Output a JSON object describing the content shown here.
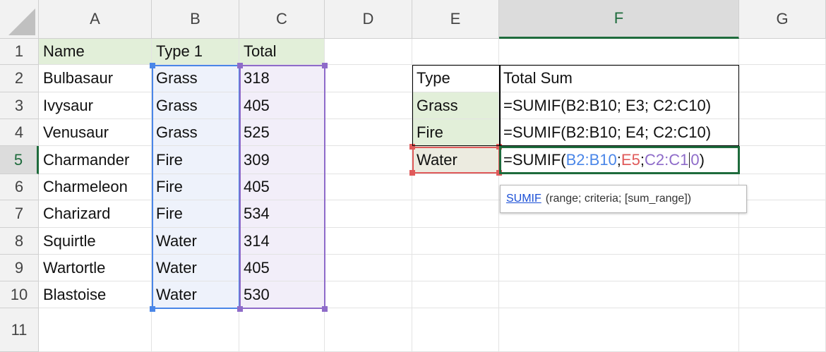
{
  "columns": [
    "A",
    "B",
    "C",
    "D",
    "E",
    "F",
    "G"
  ],
  "rows": [
    "1",
    "2",
    "3",
    "4",
    "5",
    "6",
    "7",
    "8",
    "9",
    "10",
    "11"
  ],
  "selected_column": "F",
  "selected_row": "5",
  "headers": {
    "name": "Name",
    "type1": "Type 1",
    "total": "Total"
  },
  "pokemon": [
    {
      "name": "Bulbasaur",
      "type": "Grass",
      "total": "318"
    },
    {
      "name": "Ivysaur",
      "type": "Grass",
      "total": "405"
    },
    {
      "name": "Venusaur",
      "type": "Grass",
      "total": "525"
    },
    {
      "name": "Charmander",
      "type": "Fire",
      "total": "309"
    },
    {
      "name": "Charmeleon",
      "type": "Fire",
      "total": "405"
    },
    {
      "name": "Charizard",
      "type": "Fire",
      "total": "534"
    },
    {
      "name": "Squirtle",
      "type": "Water",
      "total": "314"
    },
    {
      "name": "Wartortle",
      "type": "Water",
      "total": "405"
    },
    {
      "name": "Blastoise",
      "type": "Water",
      "total": "530"
    }
  ],
  "summary": {
    "type_header": "Type",
    "sum_header": "Total Sum",
    "rows": [
      {
        "type": "Grass",
        "formula": "=SUMIF(B2:B10; E3; C2:C10)"
      },
      {
        "type": "Fire",
        "formula": "=SUMIF(B2:B10; E4; C2:C10)"
      }
    ],
    "active": {
      "type": "Water",
      "formula_prefix": "=SUMIF(",
      "range": "B2:B10",
      "sep1": "; ",
      "criteria": "E5",
      "sep2": "; ",
      "sum_range_head": "C2:C1",
      "sum_range_tail": "0",
      "close": ")"
    }
  },
  "tooltip": {
    "function": "SUMIF",
    "args": "(range; criteria; [sum_range])"
  },
  "colors": {
    "range_blue": "#4a86e8",
    "criteria_red": "#e05a5a",
    "sum_range_purple": "#8e6bc9",
    "active_green": "#1e6b3c",
    "header_tint": "#e2efd9"
  }
}
